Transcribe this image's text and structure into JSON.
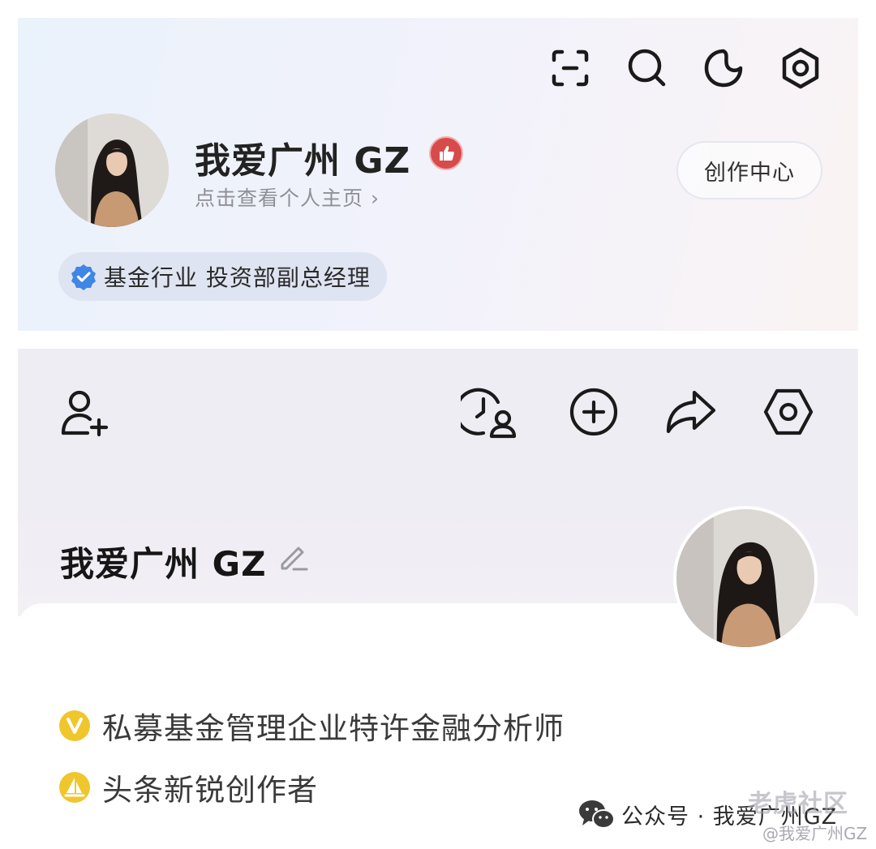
{
  "profile_header": {
    "nickname": "我爱广州 GZ",
    "profile_link": "点击查看个人主页 ›",
    "creator_center_button": "创作中心",
    "certification": "基金行业 投资部副总经理",
    "top_icons": [
      "scan-icon",
      "search-icon",
      "moon-icon",
      "settings-icon"
    ]
  },
  "profile_card": {
    "nickname": "我爱广州 GZ",
    "action_icons": [
      "add-friend-icon",
      "visitors-icon",
      "add-icon",
      "share-icon",
      "settings-icon"
    ]
  },
  "honors": [
    {
      "badge": "V",
      "label": "私募基金管理企业特许金融分析师",
      "badge_color": "#f0c62d"
    },
    {
      "badge": "sail",
      "label": "头条新锐创作者",
      "badge_color": "#f0c62d"
    }
  ],
  "footer": {
    "account_text": "公众号 · 我爱广州GZ",
    "watermark": "老虎社区",
    "watermark_handle": "@我爱广州GZ"
  }
}
